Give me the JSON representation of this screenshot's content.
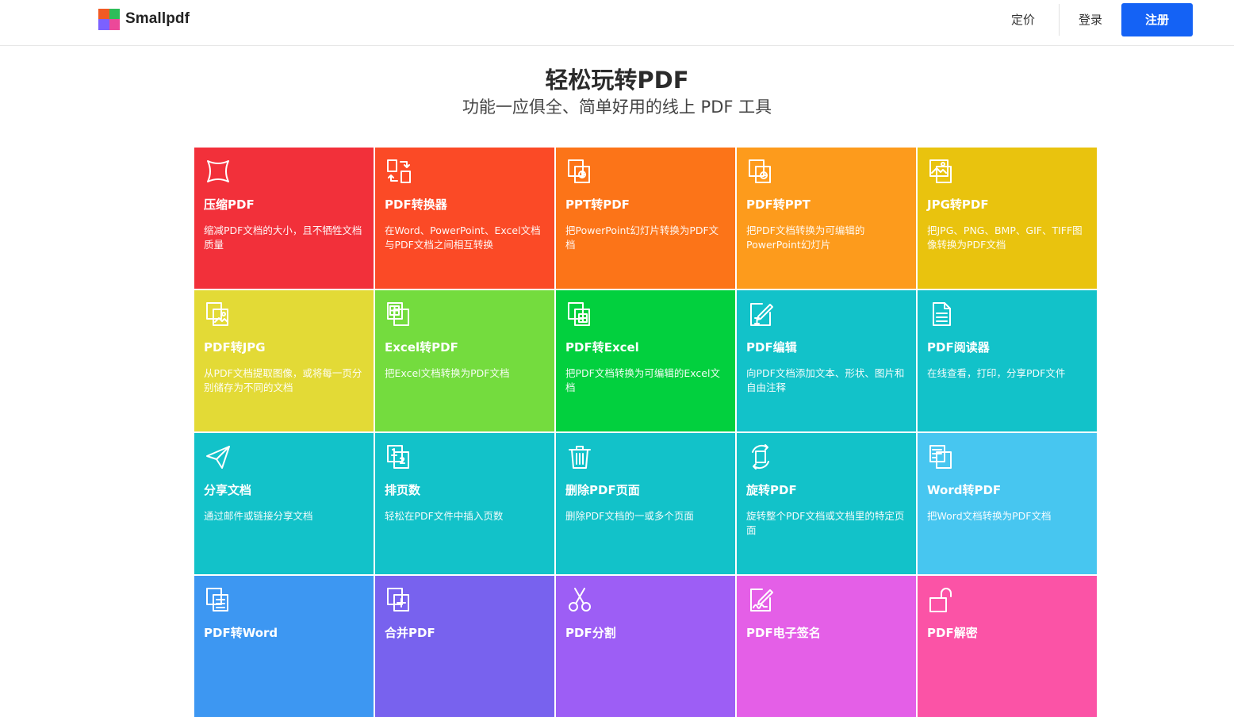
{
  "brand": {
    "name": "Smallpdf",
    "logo_colors": [
      "#f15a24",
      "#2ebd59",
      "#7b61ff",
      "#ec4899"
    ]
  },
  "nav": {
    "pricing": "定价",
    "login": "登录",
    "signup": "注册",
    "signup_color": "#1462f5"
  },
  "hero": {
    "title": "轻松玩转PDF",
    "subtitle": "功能一应俱全、简单好用的线上 PDF 工具"
  },
  "tools": [
    {
      "title": "压缩PDF",
      "desc": "缩减PDF文档的大小，且不牺牲文档质量",
      "color": "#f2303a",
      "icon": "compress-icon"
    },
    {
      "title": "PDF转换器",
      "desc": "在Word、PowerPoint、Excel文档与PDF文档之间相互转换",
      "color": "#fb4a26",
      "icon": "convert-icon"
    },
    {
      "title": "PPT转PDF",
      "desc": "把PowerPoint幻灯片转换为PDF文档",
      "color": "#fc7418",
      "icon": "ppt-icon"
    },
    {
      "title": "PDF转PPT",
      "desc": "把PDF文档转换为可编辑的PowerPoint幻灯片",
      "color": "#fd9b1c",
      "icon": "pdf-to-ppt-icon"
    },
    {
      "title": "JPG转PDF",
      "desc": "把JPG、PNG、BMP、GIF、TIFF图像转换为PDF文档",
      "color": "#e9c30e",
      "icon": "image-icon"
    },
    {
      "title": "PDF转JPG",
      "desc": "从PDF文档提取图像，或将每一页分别储存为不同的文档",
      "color": "#e3da36",
      "icon": "pdf-to-image-icon"
    },
    {
      "title": "Excel转PDF",
      "desc": "把Excel文档转换为PDF文档",
      "color": "#74dc3e",
      "icon": "excel-icon"
    },
    {
      "title": "PDF转Excel",
      "desc": "把PDF文档转换为可编辑的Excel文档",
      "color": "#02d03e",
      "icon": "pdf-to-excel-icon"
    },
    {
      "title": "PDF编辑",
      "desc": "向PDF文档添加文本、形状、图片和自由注释",
      "color": "#12c2c9",
      "icon": "edit-icon"
    },
    {
      "title": "PDF阅读器",
      "desc": "在线查看，打印，分享PDF文件",
      "color": "#12c2c9",
      "icon": "reader-icon"
    },
    {
      "title": "分享文档",
      "desc": "通过邮件或链接分享文档",
      "color": "#12c2c9",
      "icon": "paper-plane-icon"
    },
    {
      "title": "排页数",
      "desc": "轻松在PDF文件中插入页数",
      "color": "#12c2c9",
      "icon": "page-number-icon"
    },
    {
      "title": "删除PDF页面",
      "desc": "删除PDF文档的一或多个页面",
      "color": "#12c2c9",
      "icon": "trash-icon"
    },
    {
      "title": "旋转PDF",
      "desc": "旋转整个PDF文档或文档里的特定页面",
      "color": "#12c2c9",
      "icon": "rotate-icon"
    },
    {
      "title": "Word转PDF",
      "desc": "把Word文档转换为PDF文档",
      "color": "#47c6f0",
      "icon": "word-icon"
    },
    {
      "title": "PDF转Word",
      "desc": "",
      "color": "#3d97f2",
      "icon": "pdf-to-word-icon"
    },
    {
      "title": "合并PDF",
      "desc": "",
      "color": "#7862ee",
      "icon": "merge-icon"
    },
    {
      "title": "PDF分割",
      "desc": "",
      "color": "#9d5ef5",
      "icon": "scissors-icon"
    },
    {
      "title": "PDF电子签名",
      "desc": "",
      "color": "#e45fe7",
      "icon": "signature-icon"
    },
    {
      "title": "PDF解密",
      "desc": "",
      "color": "#fb53a6",
      "icon": "unlock-icon"
    }
  ]
}
